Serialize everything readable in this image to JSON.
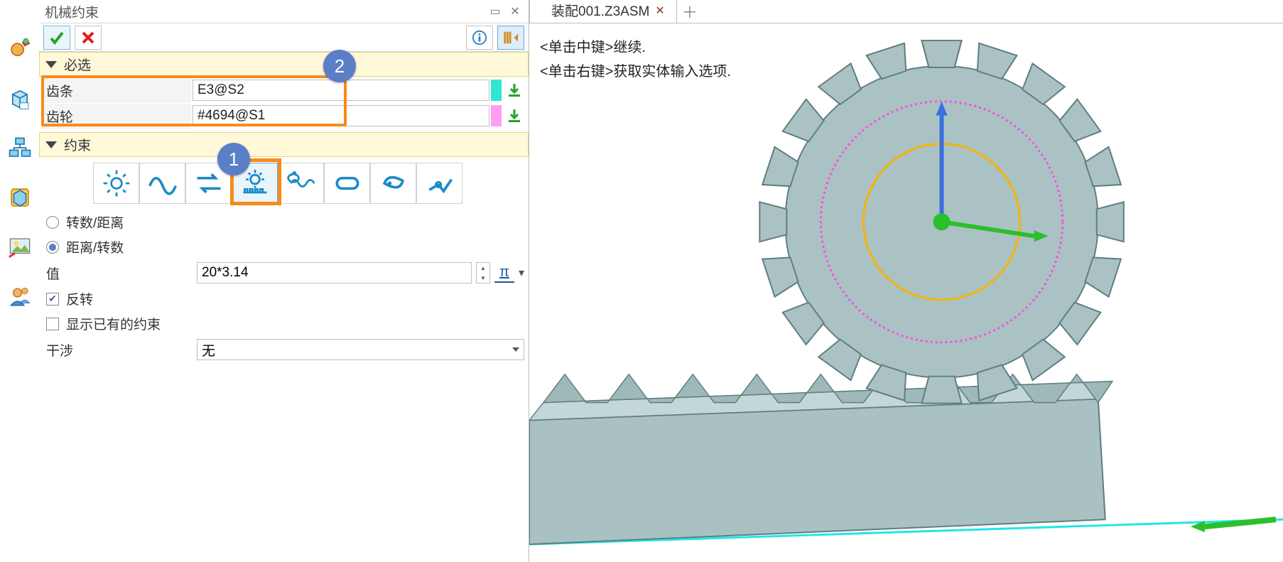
{
  "panel": {
    "title": "机械约束",
    "sections": {
      "required": "必选",
      "constraint": "约束"
    },
    "fields": {
      "rack_label": "齿条",
      "rack_value": "E3@S2",
      "gear_label": "齿轮",
      "gear_value": "#4694@S1"
    },
    "radios": {
      "rev_per_dist": "转数/距离",
      "dist_per_rev": "距离/转数"
    },
    "value_label": "值",
    "value_input": "20*3.14",
    "reverse": "反转",
    "show_existing": "显示已有的约束",
    "interference_label": "干涉",
    "interference_value": "无"
  },
  "tabs": {
    "active": "装配001.Z3ASM"
  },
  "hints": {
    "l1": "<单击中键>继续.",
    "l2": "<单击右键>获取实体输入选项."
  },
  "callouts": {
    "one": "1",
    "two": "2"
  },
  "icons": {
    "ok": "check-icon",
    "cancel": "x-icon",
    "info": "info-icon",
    "dock": "dock-icon",
    "type_gear": "gear-icon",
    "type_path": "path-icon",
    "type_linear": "linear-icon",
    "type_rack": "rack-pinion-icon",
    "type_screw": "screw-icon",
    "type_slot": "slot-icon",
    "type_cam": "cam-icon",
    "type_univ": "universal-joint-icon"
  }
}
